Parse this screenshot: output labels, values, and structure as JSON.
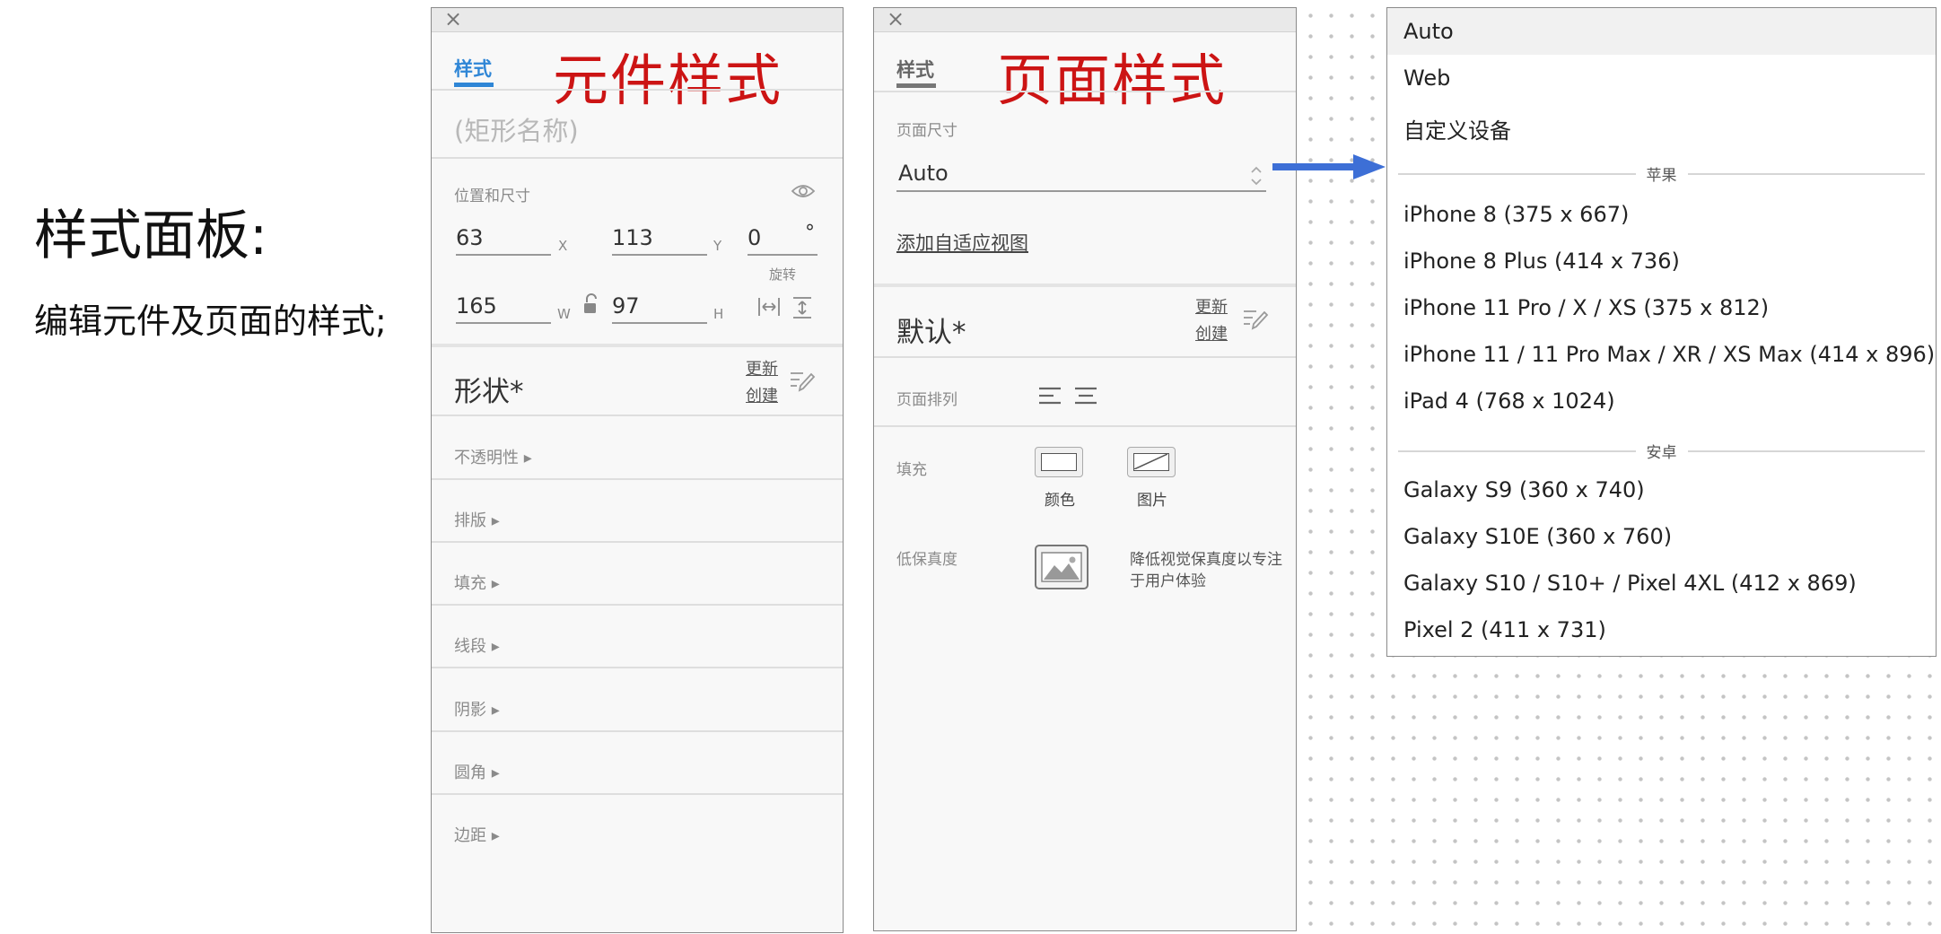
{
  "intro": {
    "title": "样式面板:",
    "description": "编辑元件及页面的样式;"
  },
  "widget_panel": {
    "tab": "样式",
    "heading": "元件样式",
    "name_placeholder": "(矩形名称)",
    "position_size": {
      "label": "位置和尺寸",
      "x_value": "63",
      "x_label": "X",
      "y_value": "113",
      "y_label": "Y",
      "rotation_value": "0",
      "rotation_unit": "°",
      "rotation_label": "旋转",
      "w_value": "165",
      "w_label": "W",
      "h_value": "97",
      "h_label": "H"
    },
    "style_name": "形状*",
    "update_link": "更新",
    "create_link": "创建",
    "sections": [
      "不透明性 ▸",
      "排版 ▸",
      "填充 ▸",
      "线段 ▸",
      "阴影 ▸",
      "圆角 ▸",
      "边距 ▸"
    ]
  },
  "page_panel": {
    "tab": "样式",
    "heading": "页面样式",
    "page_size_label": "页面尺寸",
    "page_size_value": "Auto",
    "add_adaptive_link": "添加自适应视图",
    "style_name": "默认*",
    "update_link": "更新",
    "create_link": "创建",
    "align_label": "页面排列",
    "fill_label": "填充",
    "fill_color_label": "颜色",
    "fill_image_label": "图片",
    "low_fidelity_label": "低保真度",
    "low_fidelity_desc_line1": "降低视觉保真度以专注",
    "low_fidelity_desc_line2": "于用户体验"
  },
  "dropdown": {
    "items": [
      "Auto",
      "Web",
      "自定义设备"
    ],
    "selected": "Auto",
    "apple_group": "苹果",
    "apple_items": [
      "iPhone 8  (375 x 667)",
      "iPhone 8 Plus  (414 x 736)",
      "iPhone 11 Pro / X / XS  (375 x 812)",
      "iPhone 11 / 11 Pro Max / XR / XS Max  (414 x 896)",
      "iPad 4  (768 x 1024)"
    ],
    "android_group": "安卓",
    "android_items": [
      "Galaxy S9  (360 x 740)",
      "Galaxy S10E  (360 x 760)",
      "Galaxy S10 / S10+ / Pixel 4XL  (412 x 869)",
      "Pixel 2  (411 x 731)"
    ]
  },
  "colors": {
    "accent_blue": "#2f86d6",
    "arrow_blue": "#3d6fd6",
    "heading_red": "#cc1414"
  }
}
